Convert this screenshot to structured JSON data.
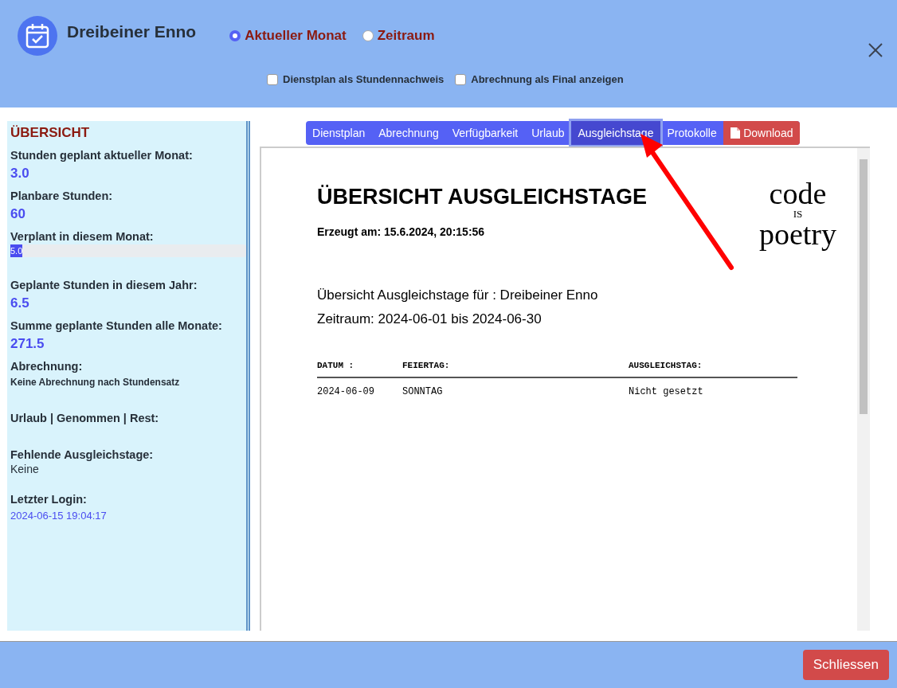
{
  "header": {
    "name": "Dreibeiner Enno",
    "period_options": [
      {
        "label": "Aktueller Monat",
        "selected": true
      },
      {
        "label": "Zeitraum",
        "selected": false
      }
    ],
    "options": [
      {
        "label": "Dienstplan als Stundennachweis",
        "checked": false
      },
      {
        "label": "Abrechnung als Final anzeigen",
        "checked": false
      }
    ]
  },
  "sidebar": {
    "title": "ÜBERSICHT",
    "items": [
      {
        "kind": "value",
        "label": "Stunden geplant aktueller Monat:",
        "value": "3.0"
      },
      {
        "kind": "value",
        "label": "Planbare Stunden:",
        "value": "60"
      },
      {
        "kind": "progress",
        "label": "Verplant in diesem Monat:",
        "value": "5.0",
        "level": 0.05
      },
      {
        "kind": "value",
        "label": "Geplante Stunden in diesem Jahr:",
        "value": "6.5"
      },
      {
        "kind": "value",
        "label": "Summe geplante Stunden alle Monate:",
        "value": "271.5"
      },
      {
        "kind": "note",
        "label": "Abrechnung:",
        "value": "Keine Abrechnung nach Stundensatz"
      },
      {
        "kind": "heading",
        "label": "Urlaub | Genommen | Rest:"
      },
      {
        "kind": "plain",
        "label": "Fehlende Ausgleichstage:",
        "value": "Keine"
      },
      {
        "kind": "date",
        "label": "Letzter Login:",
        "value": "2024-06-15 19:04:17"
      }
    ]
  },
  "tabs": [
    {
      "label": "Dienstplan",
      "selected": false
    },
    {
      "label": "Abrechnung",
      "selected": false
    },
    {
      "label": "Verfügbarkeit",
      "selected": false
    },
    {
      "label": "Urlaub",
      "selected": false
    },
    {
      "label": "Ausgleichstage",
      "selected": true
    },
    {
      "label": "Protokolle",
      "selected": false
    }
  ],
  "download_button": "Download",
  "document": {
    "title": "ÜBERSICHT AUSGLEICHSTAGE",
    "created": "Erzeugt am: 15.6.2024, 20:15:56",
    "logo": [
      "code",
      "IS",
      "poetry"
    ],
    "subtitle": "Übersicht Ausgleichstage für : Dreibeiner Enno",
    "period": "Zeitraum: 2024-06-01 bis 2024-06-30",
    "table": {
      "columns": [
        "DATUM :",
        "FEIERTAG:",
        "AUSGLEICHSTAG:"
      ],
      "rows": [
        [
          "2024-06-09",
          "SONNTAG",
          "Nicht gesetzt"
        ]
      ]
    }
  },
  "close_button": "Schliessen"
}
